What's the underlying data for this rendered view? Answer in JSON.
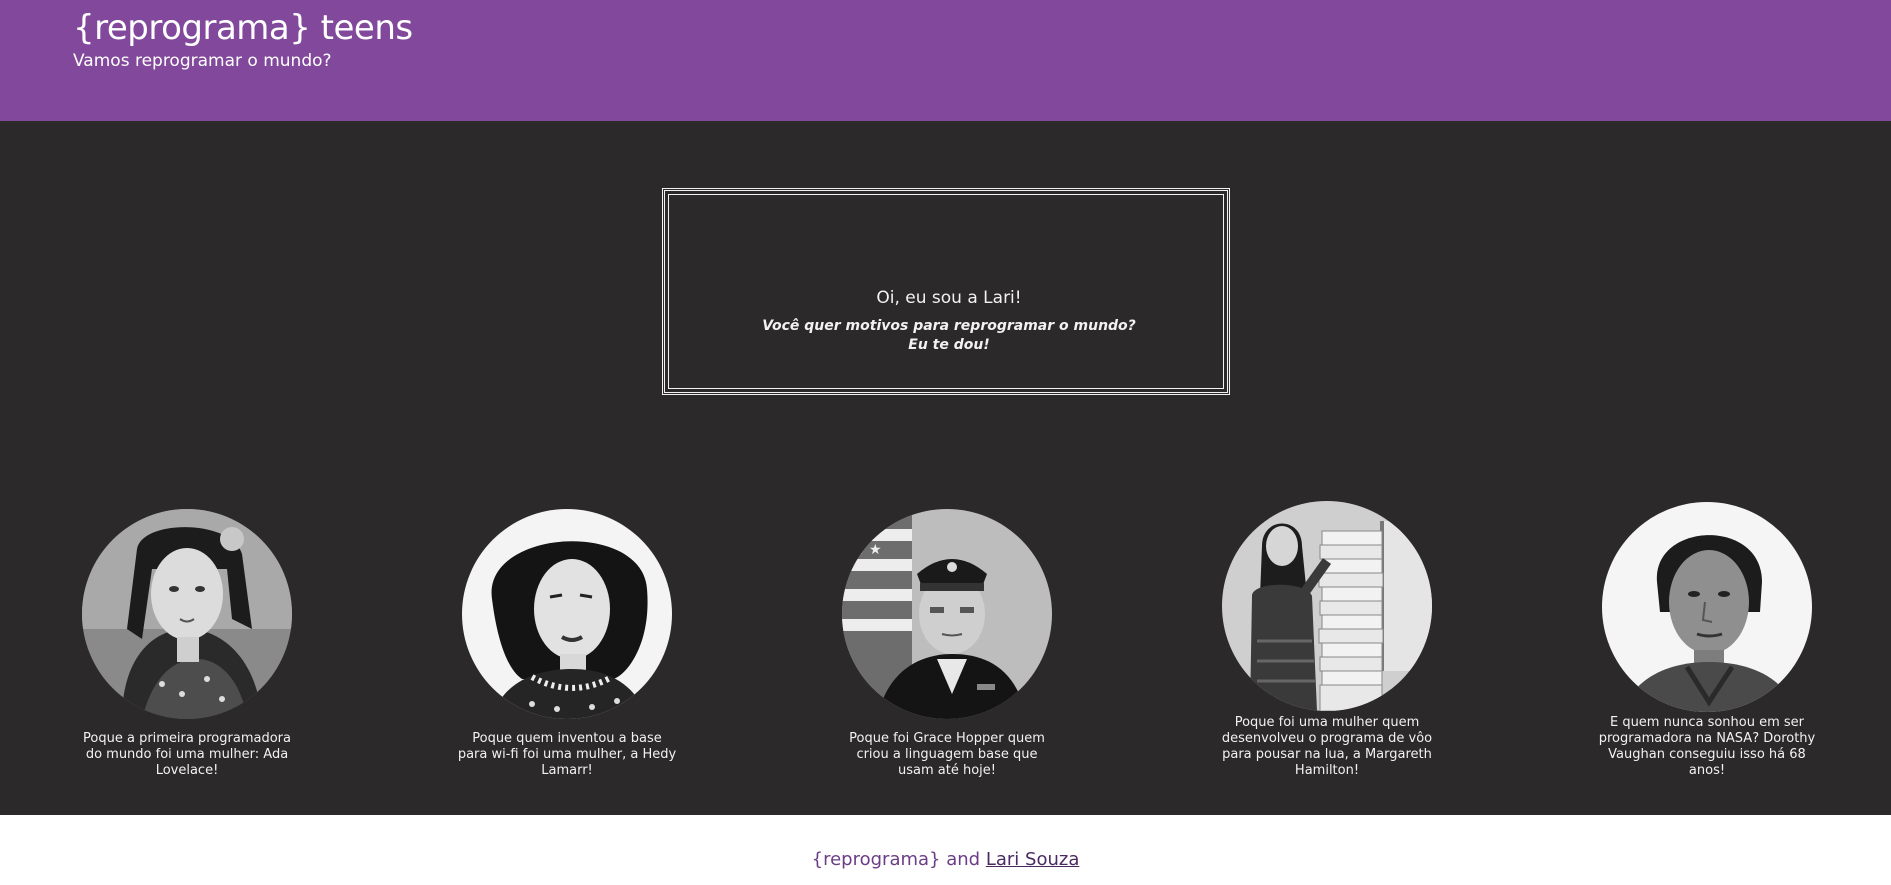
{
  "header": {
    "brand": "{reprograma} teens",
    "tagline": "Vamos reprogramar o mundo?"
  },
  "intro": {
    "greeting": "Oi, eu sou a Lari!",
    "pitch": "Você quer motivos para reprogramar o mundo? Eu te dou!"
  },
  "cards": [
    {
      "caption": "Poque a primeira programadora do mundo foi uma mulher: Ada Lovelace!"
    },
    {
      "caption": "Poque quem inventou a base para wi-fi foi uma mulher, a Hedy Lamarr!"
    },
    {
      "caption": "Poque foi Grace Hopper quem criou a linguagem base que usam até hoje!"
    },
    {
      "caption": "Poque foi uma mulher quem desenvolveu o programa de vôo para pousar na lua, a Margareth Hamilton!"
    },
    {
      "caption": "E quem nunca sonhou em ser programadora na NASA? Dorothy Vaughan conseguiu isso há 68 anos!"
    }
  ],
  "footer": {
    "org": "{reprograma}",
    "connector": "and",
    "author_link": "Lari Souza"
  },
  "colors": {
    "header_bg": "#82489b",
    "main_bg": "#2b292a",
    "footer_text": "#6a3d86"
  }
}
